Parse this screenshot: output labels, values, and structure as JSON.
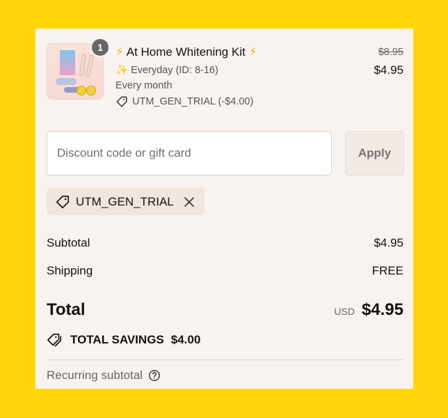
{
  "product": {
    "quantity": "1",
    "title": "At Home Whitening Kit",
    "title_prefix_icon": "⚡",
    "title_suffix_icon": "⚡",
    "variant_icon": "✨",
    "variant": "Everyday (ID: 8-16)",
    "frequency": "Every month",
    "discount_label": "UTM_GEN_TRIAL (-$4.00)",
    "original_price": "$8.95",
    "price": "$4.95"
  },
  "discount": {
    "placeholder": "Discount code or gift card",
    "apply_label": "Apply",
    "applied_code": "UTM_GEN_TRIAL"
  },
  "summary": {
    "subtotal_label": "Subtotal",
    "subtotal_value": "$4.95",
    "shipping_label": "Shipping",
    "shipping_value": "FREE",
    "total_label": "Total",
    "currency": "USD",
    "total_value": "$4.95",
    "savings_label": "TOTAL SAVINGS",
    "savings_value": "$4.00",
    "recurring_label": "Recurring subtotal"
  },
  "colors": {
    "page_background": "#FFD60A",
    "panel_background": "#F8F3EF",
    "tag_background": "#EFE6DE",
    "text_primary": "#121212",
    "text_secondary": "#666666"
  },
  "icons": {
    "tag": "tag-icon",
    "close": "close-icon",
    "tags": "tags-icon",
    "help": "help-circle-icon"
  }
}
